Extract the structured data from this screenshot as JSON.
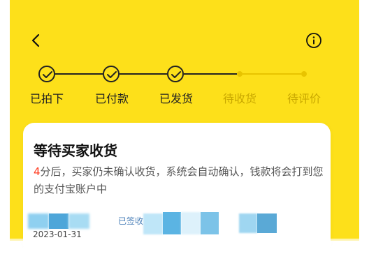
{
  "header": {
    "back_icon": "chevron-left-icon",
    "info_icon": "info-circle-icon"
  },
  "steps": [
    {
      "label": "已拍下",
      "done": true
    },
    {
      "label": "已付款",
      "done": true
    },
    {
      "label": "已发货",
      "done": true
    },
    {
      "label": "待收货",
      "done": false
    },
    {
      "label": "待评价",
      "done": false
    }
  ],
  "status_card": {
    "title": "等待买家收货",
    "countdown_highlight": "4",
    "description_rest": "分后，买家仍未确认收货，系统会自动确认，钱款将会打到您的支付宝账户中"
  },
  "logistics": {
    "status_partial": "已签收",
    "date": "2023-01-31"
  },
  "colors": {
    "background_yellow": "#fde01a",
    "highlight_red": "#ff3b1f",
    "text_dark": "#222222"
  }
}
